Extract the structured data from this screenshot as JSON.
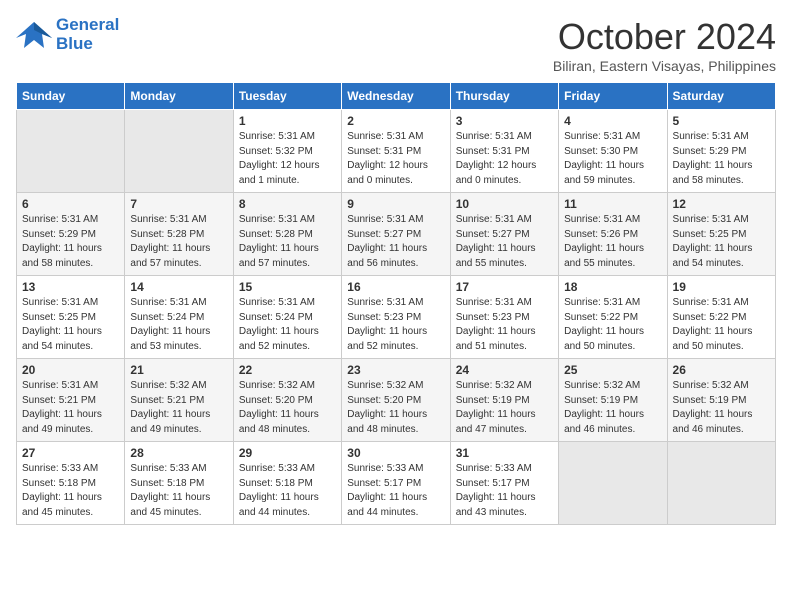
{
  "logo": {
    "line1": "General",
    "line2": "Blue"
  },
  "title": "October 2024",
  "subtitle": "Biliran, Eastern Visayas, Philippines",
  "days_of_week": [
    "Sunday",
    "Monday",
    "Tuesday",
    "Wednesday",
    "Thursday",
    "Friday",
    "Saturday"
  ],
  "weeks": [
    [
      {
        "day": "",
        "sunrise": "",
        "sunset": "",
        "daylight": ""
      },
      {
        "day": "",
        "sunrise": "",
        "sunset": "",
        "daylight": ""
      },
      {
        "day": "1",
        "sunrise": "Sunrise: 5:31 AM",
        "sunset": "Sunset: 5:32 PM",
        "daylight": "Daylight: 12 hours and 1 minute."
      },
      {
        "day": "2",
        "sunrise": "Sunrise: 5:31 AM",
        "sunset": "Sunset: 5:31 PM",
        "daylight": "Daylight: 12 hours and 0 minutes."
      },
      {
        "day": "3",
        "sunrise": "Sunrise: 5:31 AM",
        "sunset": "Sunset: 5:31 PM",
        "daylight": "Daylight: 12 hours and 0 minutes."
      },
      {
        "day": "4",
        "sunrise": "Sunrise: 5:31 AM",
        "sunset": "Sunset: 5:30 PM",
        "daylight": "Daylight: 11 hours and 59 minutes."
      },
      {
        "day": "5",
        "sunrise": "Sunrise: 5:31 AM",
        "sunset": "Sunset: 5:29 PM",
        "daylight": "Daylight: 11 hours and 58 minutes."
      }
    ],
    [
      {
        "day": "6",
        "sunrise": "Sunrise: 5:31 AM",
        "sunset": "Sunset: 5:29 PM",
        "daylight": "Daylight: 11 hours and 58 minutes."
      },
      {
        "day": "7",
        "sunrise": "Sunrise: 5:31 AM",
        "sunset": "Sunset: 5:28 PM",
        "daylight": "Daylight: 11 hours and 57 minutes."
      },
      {
        "day": "8",
        "sunrise": "Sunrise: 5:31 AM",
        "sunset": "Sunset: 5:28 PM",
        "daylight": "Daylight: 11 hours and 57 minutes."
      },
      {
        "day": "9",
        "sunrise": "Sunrise: 5:31 AM",
        "sunset": "Sunset: 5:27 PM",
        "daylight": "Daylight: 11 hours and 56 minutes."
      },
      {
        "day": "10",
        "sunrise": "Sunrise: 5:31 AM",
        "sunset": "Sunset: 5:27 PM",
        "daylight": "Daylight: 11 hours and 55 minutes."
      },
      {
        "day": "11",
        "sunrise": "Sunrise: 5:31 AM",
        "sunset": "Sunset: 5:26 PM",
        "daylight": "Daylight: 11 hours and 55 minutes."
      },
      {
        "day": "12",
        "sunrise": "Sunrise: 5:31 AM",
        "sunset": "Sunset: 5:25 PM",
        "daylight": "Daylight: 11 hours and 54 minutes."
      }
    ],
    [
      {
        "day": "13",
        "sunrise": "Sunrise: 5:31 AM",
        "sunset": "Sunset: 5:25 PM",
        "daylight": "Daylight: 11 hours and 54 minutes."
      },
      {
        "day": "14",
        "sunrise": "Sunrise: 5:31 AM",
        "sunset": "Sunset: 5:24 PM",
        "daylight": "Daylight: 11 hours and 53 minutes."
      },
      {
        "day": "15",
        "sunrise": "Sunrise: 5:31 AM",
        "sunset": "Sunset: 5:24 PM",
        "daylight": "Daylight: 11 hours and 52 minutes."
      },
      {
        "day": "16",
        "sunrise": "Sunrise: 5:31 AM",
        "sunset": "Sunset: 5:23 PM",
        "daylight": "Daylight: 11 hours and 52 minutes."
      },
      {
        "day": "17",
        "sunrise": "Sunrise: 5:31 AM",
        "sunset": "Sunset: 5:23 PM",
        "daylight": "Daylight: 11 hours and 51 minutes."
      },
      {
        "day": "18",
        "sunrise": "Sunrise: 5:31 AM",
        "sunset": "Sunset: 5:22 PM",
        "daylight": "Daylight: 11 hours and 50 minutes."
      },
      {
        "day": "19",
        "sunrise": "Sunrise: 5:31 AM",
        "sunset": "Sunset: 5:22 PM",
        "daylight": "Daylight: 11 hours and 50 minutes."
      }
    ],
    [
      {
        "day": "20",
        "sunrise": "Sunrise: 5:31 AM",
        "sunset": "Sunset: 5:21 PM",
        "daylight": "Daylight: 11 hours and 49 minutes."
      },
      {
        "day": "21",
        "sunrise": "Sunrise: 5:32 AM",
        "sunset": "Sunset: 5:21 PM",
        "daylight": "Daylight: 11 hours and 49 minutes."
      },
      {
        "day": "22",
        "sunrise": "Sunrise: 5:32 AM",
        "sunset": "Sunset: 5:20 PM",
        "daylight": "Daylight: 11 hours and 48 minutes."
      },
      {
        "day": "23",
        "sunrise": "Sunrise: 5:32 AM",
        "sunset": "Sunset: 5:20 PM",
        "daylight": "Daylight: 11 hours and 48 minutes."
      },
      {
        "day": "24",
        "sunrise": "Sunrise: 5:32 AM",
        "sunset": "Sunset: 5:19 PM",
        "daylight": "Daylight: 11 hours and 47 minutes."
      },
      {
        "day": "25",
        "sunrise": "Sunrise: 5:32 AM",
        "sunset": "Sunset: 5:19 PM",
        "daylight": "Daylight: 11 hours and 46 minutes."
      },
      {
        "day": "26",
        "sunrise": "Sunrise: 5:32 AM",
        "sunset": "Sunset: 5:19 PM",
        "daylight": "Daylight: 11 hours and 46 minutes."
      }
    ],
    [
      {
        "day": "27",
        "sunrise": "Sunrise: 5:33 AM",
        "sunset": "Sunset: 5:18 PM",
        "daylight": "Daylight: 11 hours and 45 minutes."
      },
      {
        "day": "28",
        "sunrise": "Sunrise: 5:33 AM",
        "sunset": "Sunset: 5:18 PM",
        "daylight": "Daylight: 11 hours and 45 minutes."
      },
      {
        "day": "29",
        "sunrise": "Sunrise: 5:33 AM",
        "sunset": "Sunset: 5:18 PM",
        "daylight": "Daylight: 11 hours and 44 minutes."
      },
      {
        "day": "30",
        "sunrise": "Sunrise: 5:33 AM",
        "sunset": "Sunset: 5:17 PM",
        "daylight": "Daylight: 11 hours and 44 minutes."
      },
      {
        "day": "31",
        "sunrise": "Sunrise: 5:33 AM",
        "sunset": "Sunset: 5:17 PM",
        "daylight": "Daylight: 11 hours and 43 minutes."
      },
      {
        "day": "",
        "sunrise": "",
        "sunset": "",
        "daylight": ""
      },
      {
        "day": "",
        "sunrise": "",
        "sunset": "",
        "daylight": ""
      }
    ]
  ]
}
